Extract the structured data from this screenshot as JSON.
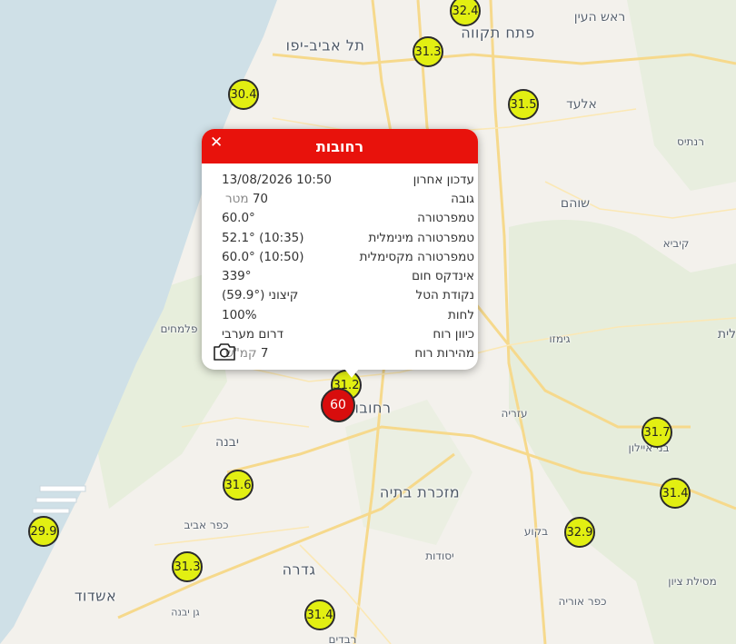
{
  "popup": {
    "title": "רחובות",
    "close_icon": "close-icon",
    "camera_icon": "camera-icon",
    "rows": [
      {
        "label": "עדכון אחרון",
        "value": "13/08/2026 10:50",
        "unit": ""
      },
      {
        "label": "גובה",
        "value": "70",
        "unit": "מטר"
      },
      {
        "label": "טמפרטורה",
        "value": "60.0°",
        "unit": ""
      },
      {
        "label": "טמפרטורה מינימלית",
        "value": "52.1° (10:35)",
        "unit": ""
      },
      {
        "label": "טמפרטורה מקסימלית",
        "value": "60.0° (10:50)",
        "unit": ""
      },
      {
        "label": "אינדקס חום",
        "value": "339°",
        "unit": ""
      },
      {
        "label": "נקודת הטל",
        "value": "קיצוני (59.9°)",
        "unit": ""
      },
      {
        "label": "לחות",
        "value": "100%",
        "unit": ""
      },
      {
        "label": "כיוון רוח",
        "value": "דרום מערבי",
        "unit": ""
      },
      {
        "label": "מהירות רוח",
        "value": "7",
        "unit": "קמ\"ש"
      }
    ]
  },
  "selected_station": {
    "value": "60",
    "color": "#d80d0d"
  },
  "stations": [
    {
      "value": "32.4"
    },
    {
      "value": "31.3"
    },
    {
      "value": "30.4"
    },
    {
      "value": "31.5"
    },
    {
      "value": "31.2"
    },
    {
      "value": "31.7"
    },
    {
      "value": "31.6"
    },
    {
      "value": "31.4"
    },
    {
      "value": "32.9"
    },
    {
      "value": "29.9"
    },
    {
      "value": "31.3"
    },
    {
      "value": "31.4"
    }
  ],
  "places": [
    {
      "name": "ראש העין"
    },
    {
      "name": "פתח תקווה"
    },
    {
      "name": "תל אביב-יפו"
    },
    {
      "name": "אלעד"
    },
    {
      "name": "רנתיס"
    },
    {
      "name": "שוהם"
    },
    {
      "name": "קיביא"
    },
    {
      "name": "גימזו"
    },
    {
      "name": "לית"
    },
    {
      "name": "פלמחים"
    },
    {
      "name": "רחובות"
    },
    {
      "name": "עזריה"
    },
    {
      "name": "יבנה"
    },
    {
      "name": "בני איילון"
    },
    {
      "name": "מזכרת בתיה"
    },
    {
      "name": "כפר אביב"
    },
    {
      "name": "בקוע"
    },
    {
      "name": "יסודות"
    },
    {
      "name": "גדרה"
    },
    {
      "name": "אשדוד"
    },
    {
      "name": "גן יבנה"
    },
    {
      "name": "מסילת ציון"
    },
    {
      "name": "כפר אוריה"
    },
    {
      "name": "רבדים"
    }
  ],
  "colors": {
    "station_fill": "#e2ef12",
    "selected_fill": "#d80d0d",
    "header": "#e8120c",
    "sea": "#cfe0e7"
  }
}
